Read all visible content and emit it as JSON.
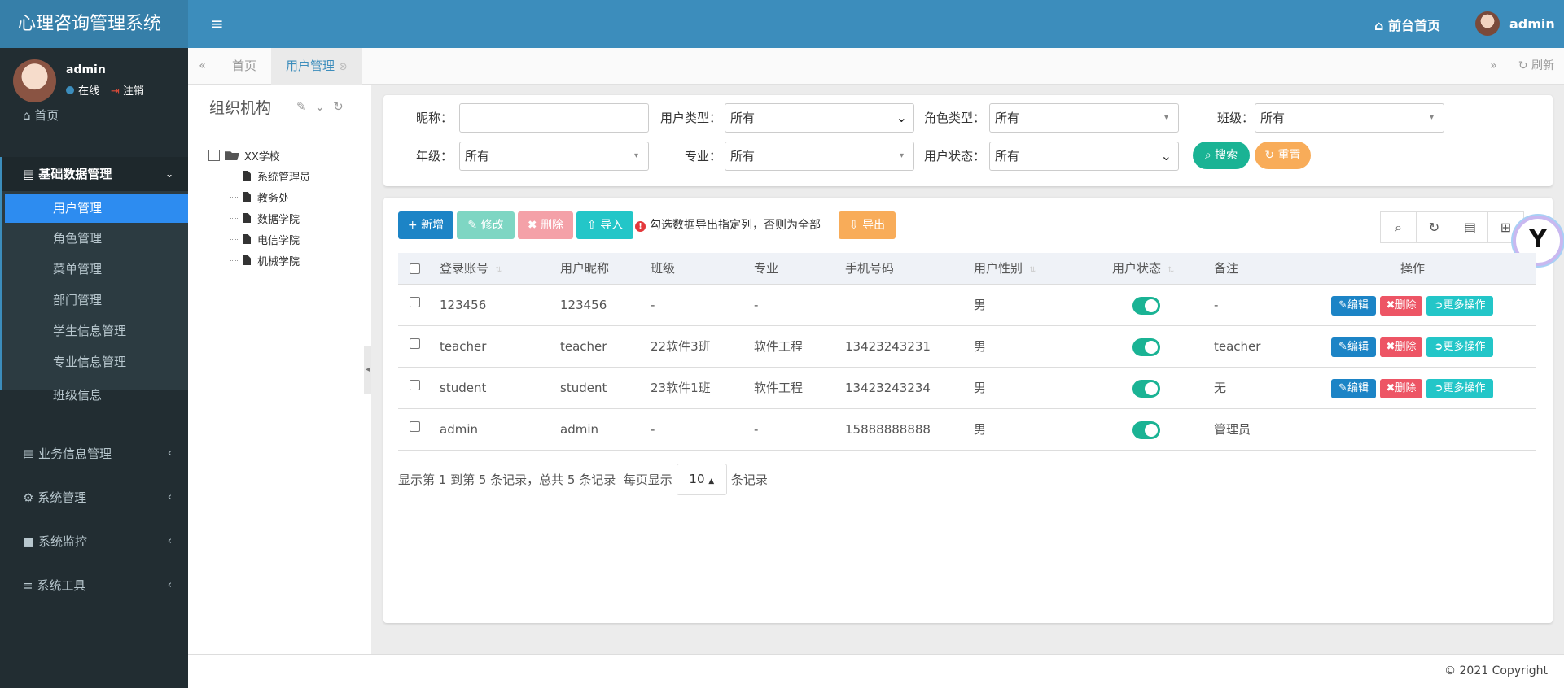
{
  "app": {
    "title": "心理咨询管理系统",
    "front_link": "前台首页",
    "user": "admin"
  },
  "user_panel": {
    "name": "admin",
    "online": "在线",
    "logout": "注销"
  },
  "sidebar": {
    "home": "首页",
    "basic_group": "基础数据管理",
    "basic_items": [
      "用户管理",
      "角色管理",
      "菜单管理",
      "部门管理",
      "学生信息管理",
      "专业信息管理",
      "班级信息"
    ],
    "groups": [
      "业务信息管理",
      "系统管理",
      "系统监控",
      "系统工具"
    ]
  },
  "tabs": {
    "items": [
      "首页",
      "用户管理"
    ],
    "refresh": "刷新"
  },
  "org": {
    "title": "组织机构",
    "root": "XX学校",
    "children": [
      "系统管理员",
      "教务处",
      "数据学院",
      "电信学院",
      "机械学院"
    ]
  },
  "search": {
    "nickname_label": "昵称：",
    "nickname_value": "",
    "user_type_label": "用户类型：",
    "user_type_value": "所有",
    "role_type_label": "角色类型：",
    "role_type_value": "所有",
    "class_label": "班级：",
    "class_value": "所有",
    "grade_label": "年级：",
    "grade_value": "所有",
    "major_label": "专业：",
    "major_value": "所有",
    "status_label": "用户状态：",
    "status_value": "所有",
    "search_btn": "搜索",
    "reset_btn": "重置"
  },
  "toolbar": {
    "add": "新增",
    "edit": "修改",
    "delete": "删除",
    "import": "导入",
    "hint": "勾选数据导出指定列，否则为全部",
    "export": "导出"
  },
  "table": {
    "headers": [
      "登录账号",
      "用户昵称",
      "班级",
      "专业",
      "手机号码",
      "用户性别",
      "用户状态",
      "备注",
      "操作"
    ],
    "rows": [
      {
        "account": "123456",
        "nickname": "123456",
        "class": "-",
        "major": "-",
        "phone": "",
        "gender": "男",
        "status": true,
        "remark": "-"
      },
      {
        "account": "teacher",
        "nickname": "teacher",
        "class": "22软件3班",
        "major": "软件工程",
        "phone": "13423243231",
        "gender": "男",
        "status": true,
        "remark": "teacher"
      },
      {
        "account": "student",
        "nickname": "student",
        "class": "23软件1班",
        "major": "软件工程",
        "phone": "13423243234",
        "gender": "男",
        "status": true,
        "remark": "无"
      },
      {
        "account": "admin",
        "nickname": "admin",
        "class": "-",
        "major": "-",
        "phone": "15888888888",
        "gender": "男",
        "status": true,
        "remark": "管理员"
      }
    ],
    "actions": {
      "edit": "编辑",
      "delete": "删除",
      "more": "更多操作"
    }
  },
  "pager": {
    "prefix": "显示第 1 到第 5 条记录，总共 5 条记录",
    "per_page_label": "每页显示",
    "per_page": "10",
    "suffix": "条记录"
  },
  "footer": {
    "copyright": "© 2021 Copyright"
  },
  "colors": {
    "primary": "#3c8dbc",
    "sidebar": "#222d32",
    "active": "#2d8cf0",
    "success": "#1ab394",
    "danger": "#ed5565",
    "warning": "#f8ac59"
  }
}
